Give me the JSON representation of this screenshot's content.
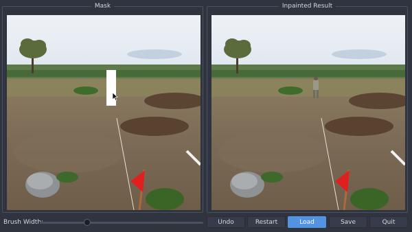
{
  "panels": {
    "mask_title": "Mask",
    "result_title": "Inpainted Result"
  },
  "brush": {
    "label": "Brush Width:",
    "level": 0.29
  },
  "buttons": {
    "undo": "Undo",
    "restart": "Restart",
    "load": "Load",
    "save": "Save",
    "quit": "Quit"
  },
  "colors": {
    "window_bg": "#2f343f",
    "accent": "#5294e2",
    "button_bg": "#383c4a",
    "mask_fill": "#ffffff",
    "flag_red": "#e0201e"
  },
  "icons": {
    "cursor": "cursor-arrow-icon"
  }
}
